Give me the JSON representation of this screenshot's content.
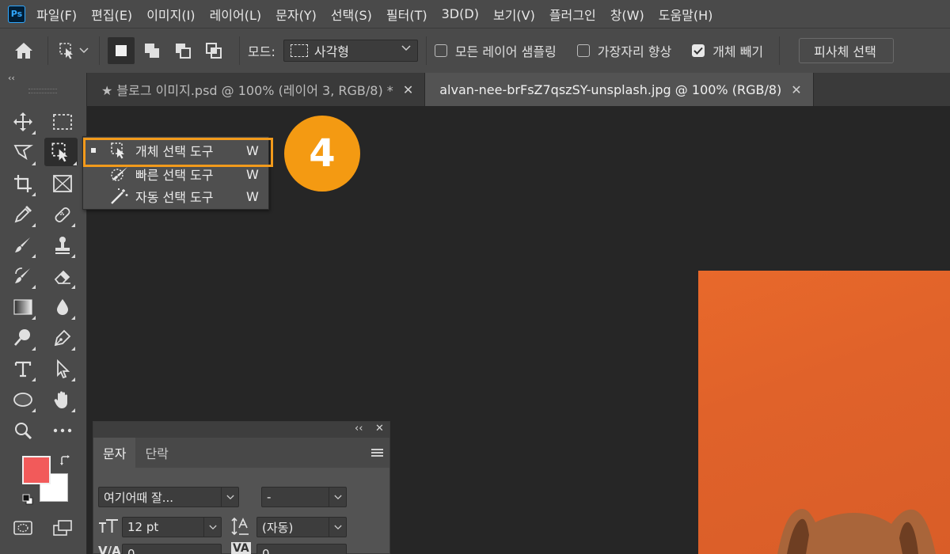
{
  "app": {
    "logo_text": "Ps"
  },
  "menu": [
    "파일(F)",
    "편집(E)",
    "이미지(I)",
    "레이어(L)",
    "문자(Y)",
    "선택(S)",
    "필터(T)",
    "3D(D)",
    "보기(V)",
    "플러그인",
    "창(W)",
    "도움말(H)"
  ],
  "options": {
    "mode_label": "모드:",
    "mode_value": "사각형",
    "sample_all_layers": "모든 레이어 샘플링",
    "hard_edge": "가장자리 향상",
    "object_subtract": "개체 빼기",
    "object_subtract_checked": true,
    "select_subject": "피사체 선택"
  },
  "tabs": [
    {
      "label": "★ 블로그 이미지.psd @ 100% (레이어 3, RGB/8) *",
      "active": false
    },
    {
      "label": "alvan-nee-brFsZ7qszSY-unsplash.jpg @ 100% (RGB/8)",
      "active": true
    }
  ],
  "toolbar": {
    "collapse": "‹‹",
    "colors": {
      "foreground": "#f25a5a",
      "background": "#ffffff"
    }
  },
  "flyout": {
    "items": [
      {
        "label": "개체 선택 도구",
        "key": "W",
        "selected": true,
        "icon": "object-selection-icon"
      },
      {
        "label": "빠른 선택 도구",
        "key": "W",
        "selected": false,
        "icon": "quick-selection-icon"
      },
      {
        "label": "자동 선택 도구",
        "key": "W",
        "selected": false,
        "icon": "magic-wand-icon"
      }
    ]
  },
  "annotation": {
    "step": "4",
    "color": "#f49a12"
  },
  "character_panel": {
    "collapse": "‹‹",
    "close": "✕",
    "tabs": [
      "문자",
      "단락"
    ],
    "font_family": "여기어때 잘...",
    "font_style": "-",
    "font_size": "12 pt",
    "leading": "(자동)",
    "kerning": "0",
    "tracking": "0"
  },
  "canvas": {
    "image_color": "#e0622a"
  }
}
